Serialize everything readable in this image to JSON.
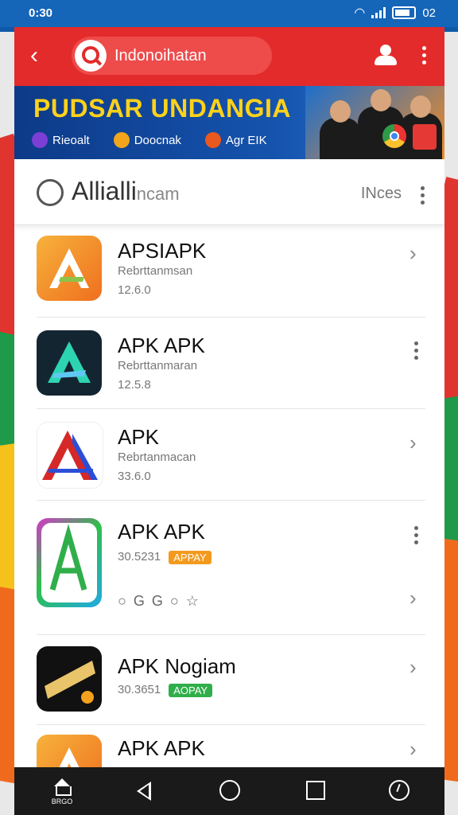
{
  "status_bar": {
    "time": "0:30",
    "battery_text": "02"
  },
  "top_bar": {
    "search_text": "Indonoihatan"
  },
  "banner": {
    "title": "PUDSAR UNDANGIA",
    "chips": [
      {
        "label": "Rieoalt",
        "color": "#7b3fd6"
      },
      {
        "label": "Doocnak",
        "color": "#f0a51d"
      },
      {
        "label": "Agr EIK",
        "color": "#e8581f"
      }
    ]
  },
  "section": {
    "title": "Allialli",
    "title_suffix": "ncam",
    "right_label": "INces"
  },
  "apps": [
    {
      "title": "APSIAPK",
      "subtitle": "Rebrttanmsan",
      "meta": "12.6.0",
      "badge": "",
      "action": "chevron"
    },
    {
      "title": "APK APK",
      "subtitle": "Rebrttanmaran",
      "meta": "12.5.8",
      "badge": "",
      "action": "menu"
    },
    {
      "title": "APK",
      "subtitle": "Rebrtanmacan",
      "meta": "33.6.0",
      "badge": "",
      "action": "chevron"
    },
    {
      "title": "APK APK",
      "subtitle": "",
      "meta": "30.5231",
      "badge": "APPAY",
      "badge_color": "#f39a1e",
      "icons_row": "○ G G ○ ☆",
      "action": "menu"
    },
    {
      "title": "APK Nogiam",
      "subtitle": "",
      "meta": "30.3651",
      "badge": "AOPAY",
      "badge_color": "#2fae4a",
      "action": "chevron"
    },
    {
      "title": "APK APK",
      "subtitle": "",
      "meta": "",
      "badge": "",
      "action": "chevron"
    }
  ],
  "nav": {
    "home_label": "BRGO"
  },
  "colors": {
    "accent_red": "#e32b2b",
    "banner_blue": "#0d3a88",
    "banner_yellow": "#ffd21a"
  }
}
